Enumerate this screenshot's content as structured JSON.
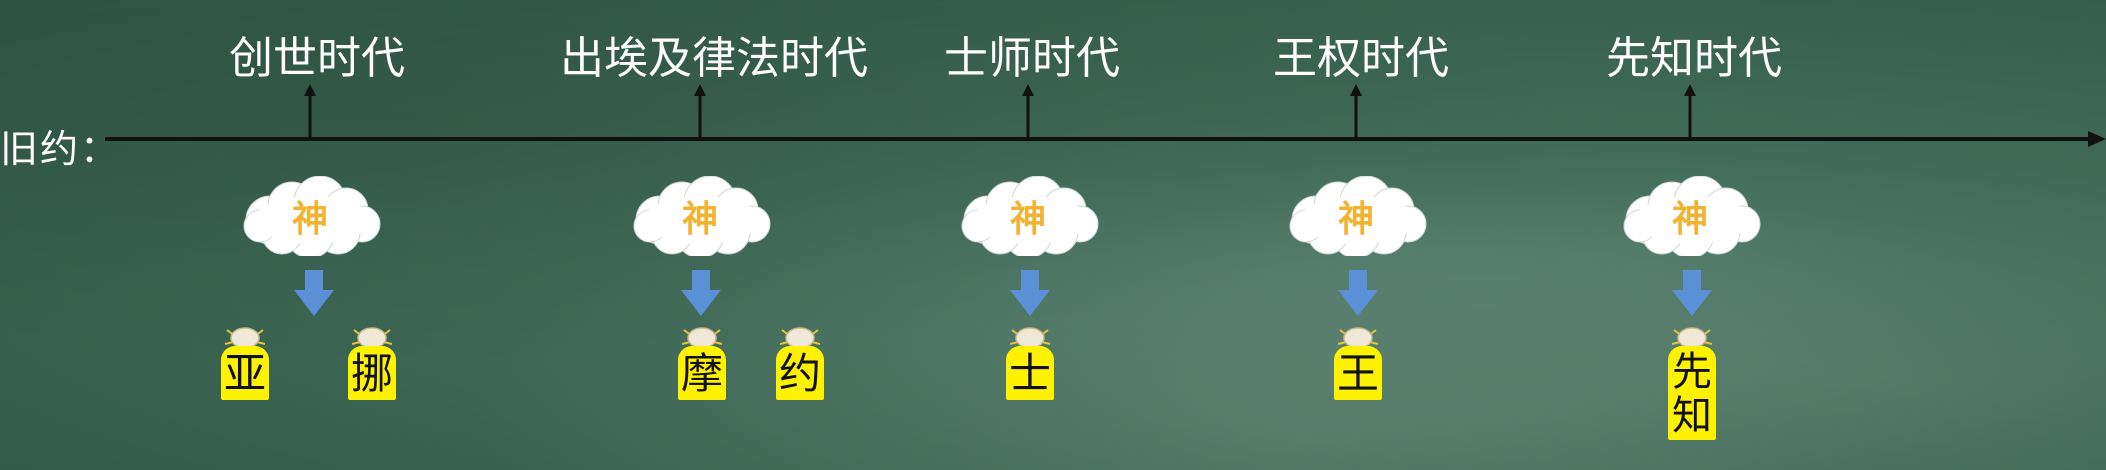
{
  "axis_label": "旧约：",
  "colors": {
    "background": "#3f6a57",
    "timeline": "#111111",
    "god_text": "#f2b233",
    "arrow": "#5b8fd6",
    "person_body": "#fff200",
    "title": "#ffffff"
  },
  "eras": [
    {
      "title": "创世时代",
      "god": "神",
      "people": [
        "亚",
        "挪"
      ]
    },
    {
      "title": "出埃及律法时代",
      "god": "神",
      "people": [
        "摩",
        "约"
      ]
    },
    {
      "title": "士师时代",
      "god": "神",
      "people": [
        "士"
      ]
    },
    {
      "title": "王权时代",
      "god": "神",
      "people": [
        "王"
      ]
    },
    {
      "title": "先知时代",
      "god": "神",
      "people": [
        "先知"
      ]
    }
  ]
}
